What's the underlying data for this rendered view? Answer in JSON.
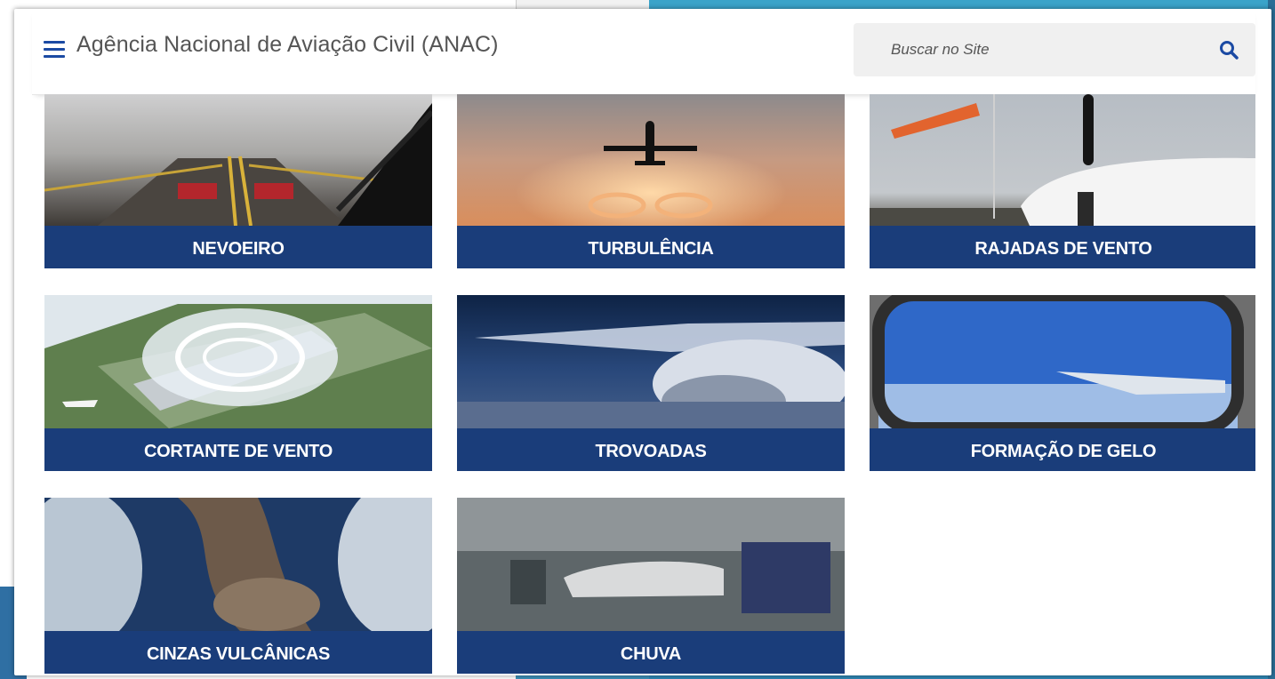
{
  "header": {
    "menu_icon": "hamburger-menu-icon",
    "site_title": "Agência Nacional de Aviação Civil (ANAC)",
    "search": {
      "placeholder": "Buscar no Site",
      "icon": "search-icon",
      "accent_color": "#1b4aa3"
    }
  },
  "tiles": [
    {
      "label": "NEVOEIRO"
    },
    {
      "label": "TURBULÊNCIA"
    },
    {
      "label": "RAJADAS DE VENTO"
    },
    {
      "label": "CORTANTE DE VENTO"
    },
    {
      "label": "TROVOADAS"
    },
    {
      "label": "FORMAÇÃO DE GELO"
    },
    {
      "label": "CINZAS VULCÂNICAS"
    },
    {
      "label": "CHUVA"
    }
  ],
  "colors": {
    "tile_label_background": "#1a3d7a",
    "tile_label_text": "#ffffff"
  }
}
